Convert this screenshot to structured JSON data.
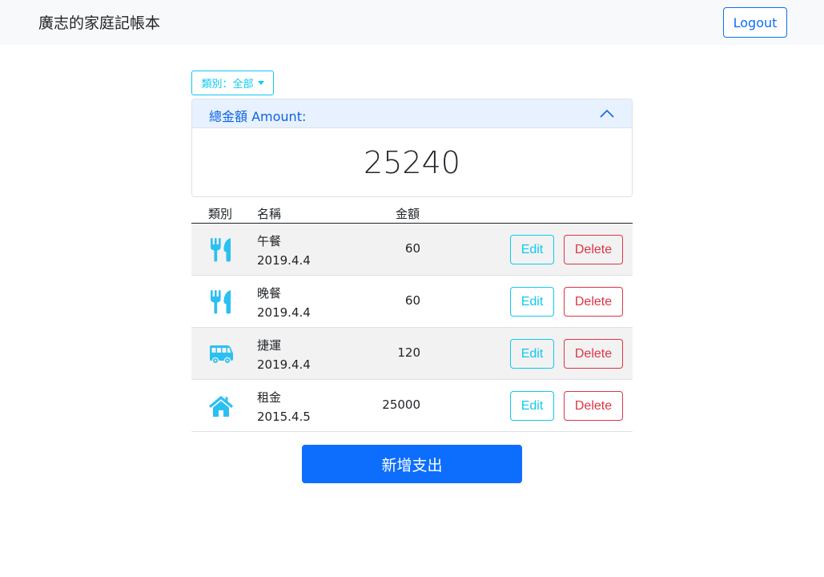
{
  "navbar": {
    "brand": "廣志的家庭記帳本",
    "logout_label": "Logout"
  },
  "filter": {
    "label": "類別：全部"
  },
  "summary": {
    "header": "總金額 Amount:",
    "total": "25240"
  },
  "table": {
    "headers": {
      "category": "類別",
      "name": "名稱",
      "amount": "金額"
    },
    "rows": [
      {
        "icon": "utensils-icon",
        "name": "午餐",
        "date": "2019.4.4",
        "amount": "60"
      },
      {
        "icon": "utensils-icon",
        "name": "晚餐",
        "date": "2019.4.4",
        "amount": "60"
      },
      {
        "icon": "bus-icon",
        "name": "捷運",
        "date": "2019.4.4",
        "amount": "120"
      },
      {
        "icon": "home-icon",
        "name": "租金",
        "date": "2015.4.5",
        "amount": "25000"
      }
    ],
    "edit_label": "Edit",
    "delete_label": "Delete"
  },
  "add_button_label": "新增支出",
  "colors": {
    "primary": "#0d6efd",
    "info": "#0dcaf0",
    "danger": "#dc3545",
    "icon": "#2bc0f2",
    "accordion_header_bg": "#e7f1ff"
  }
}
